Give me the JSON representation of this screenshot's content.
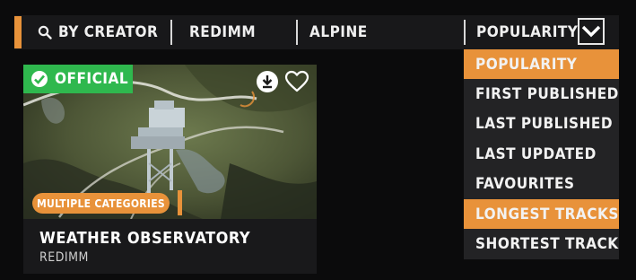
{
  "filter_bar": {
    "creator_label": "BY CREATOR",
    "filter1_label": "REDIMM",
    "filter2_label": "ALPINE",
    "sort_label": "POPULARITY"
  },
  "sort_menu": {
    "options": [
      {
        "label": "POPULARITY",
        "highlighted": true
      },
      {
        "label": "FIRST PUBLISHED",
        "highlighted": false
      },
      {
        "label": "LAST PUBLISHED",
        "highlighted": false
      },
      {
        "label": "LAST UPDATED",
        "highlighted": false
      },
      {
        "label": "FAVOURITES",
        "highlighted": false
      },
      {
        "label": "LONGEST TRACKS",
        "highlighted": true
      },
      {
        "label": "SHORTEST TRACKS",
        "highlighted": false
      }
    ]
  },
  "track_card": {
    "official_label": "OFFICIAL",
    "category_label": "MULTIPLE CATEGORIES",
    "title": "WEATHER OBSERVATORY",
    "author": "REDIMM",
    "icons": [
      "download-icon",
      "heart-icon"
    ]
  },
  "colors": {
    "accent": "#e8923a",
    "official_green": "#2fb84e",
    "bar_bg": "#18181a",
    "menu_bg": "#232325"
  }
}
